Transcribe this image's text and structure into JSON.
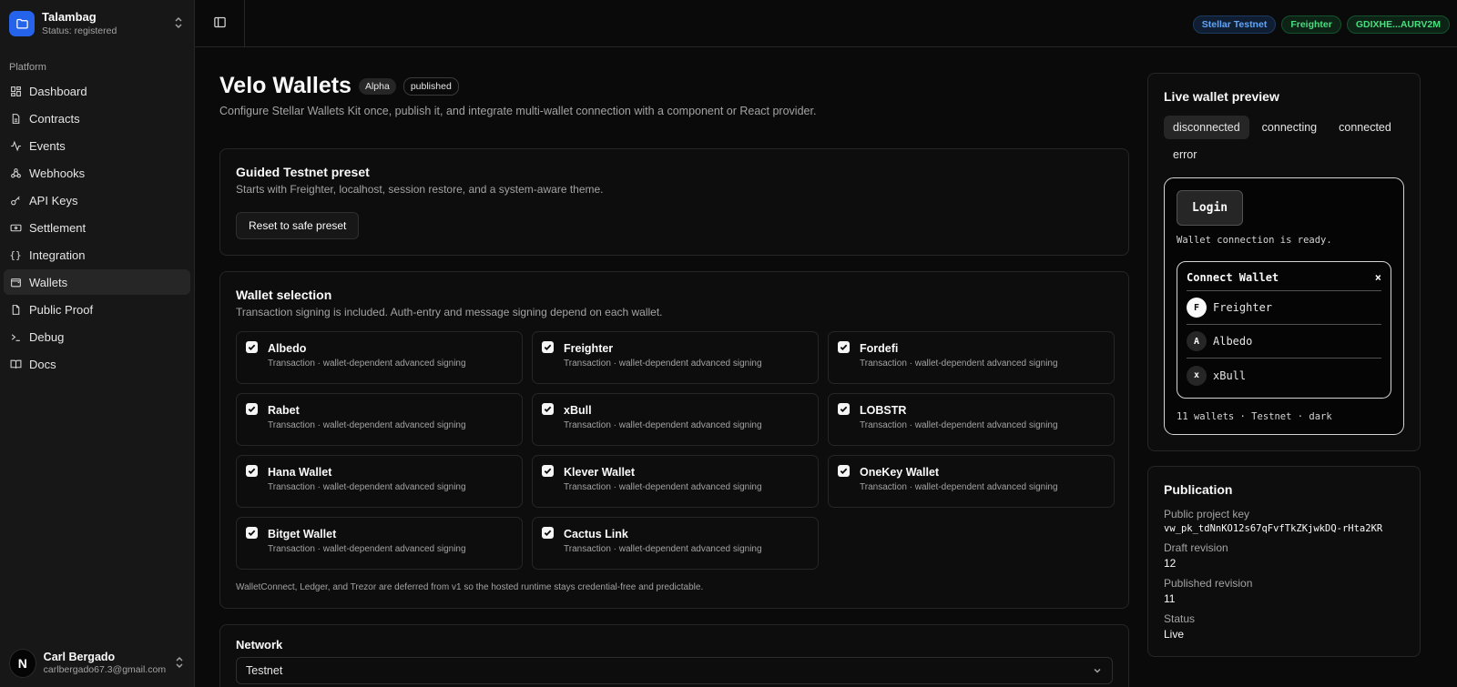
{
  "workspace": {
    "name": "Talambag",
    "status": "Status: registered"
  },
  "sidebar": {
    "group_label": "Platform",
    "items": [
      {
        "label": "Dashboard",
        "icon": "dashboard-icon"
      },
      {
        "label": "Contracts",
        "icon": "document-icon"
      },
      {
        "label": "Events",
        "icon": "activity-icon"
      },
      {
        "label": "Webhooks",
        "icon": "webhook-icon"
      },
      {
        "label": "API Keys",
        "icon": "key-icon"
      },
      {
        "label": "Settlement",
        "icon": "banknote-icon"
      },
      {
        "label": "Integration",
        "icon": "braces-icon"
      },
      {
        "label": "Wallets",
        "icon": "wallet-icon",
        "active": true
      },
      {
        "label": "Public Proof",
        "icon": "file-icon"
      },
      {
        "label": "Debug",
        "icon": "terminal-icon"
      },
      {
        "label": "Docs",
        "icon": "book-icon"
      }
    ]
  },
  "user": {
    "initial": "N",
    "name": "Carl Bergado",
    "email": "carlbergado67.3@gmail.com"
  },
  "topbar": {
    "network": "Stellar Testnet",
    "wallet": "Freighter",
    "account": "GDIXHE...AURV2M"
  },
  "page": {
    "title": "Velo Wallets",
    "badge_alpha": "Alpha",
    "badge_status": "published",
    "subtitle": "Configure Stellar Wallets Kit once, publish it, and integrate multi-wallet connection with a component or React provider."
  },
  "preset": {
    "title": "Guided Testnet preset",
    "desc": "Starts with Freighter, localhost, session restore, and a system-aware theme.",
    "button": "Reset to safe preset"
  },
  "wallet_selection": {
    "title": "Wallet selection",
    "desc": "Transaction signing is included. Auth-entry and message signing depend on each wallet.",
    "items": [
      {
        "name": "Albedo",
        "desc": "Transaction · wallet-dependent advanced signing"
      },
      {
        "name": "Freighter",
        "desc": "Transaction · wallet-dependent advanced signing"
      },
      {
        "name": "Fordefi",
        "desc": "Transaction · wallet-dependent advanced signing"
      },
      {
        "name": "Rabet",
        "desc": "Transaction · wallet-dependent advanced signing"
      },
      {
        "name": "xBull",
        "desc": "Transaction · wallet-dependent advanced signing"
      },
      {
        "name": "LOBSTR",
        "desc": "Transaction · wallet-dependent advanced signing"
      },
      {
        "name": "Hana Wallet",
        "desc": "Transaction · wallet-dependent advanced signing"
      },
      {
        "name": "Klever Wallet",
        "desc": "Transaction · wallet-dependent advanced signing"
      },
      {
        "name": "OneKey Wallet",
        "desc": "Transaction · wallet-dependent advanced signing"
      },
      {
        "name": "Bitget Wallet",
        "desc": "Transaction · wallet-dependent advanced signing"
      },
      {
        "name": "Cactus Link",
        "desc": "Transaction · wallet-dependent advanced signing"
      }
    ],
    "note": "WalletConnect, Ledger, and Trezor are deferred from v1 so the hosted runtime stays credential-free and predictable."
  },
  "network": {
    "label": "Network",
    "value": "Testnet"
  },
  "live_preview": {
    "title": "Live wallet preview",
    "states": [
      "disconnected",
      "connecting",
      "connected",
      "error"
    ],
    "active_state": "disconnected",
    "login": "Login",
    "ready": "Wallet connection is ready.",
    "modal_title": "Connect Wallet",
    "modal_close": "×",
    "modal_items": [
      {
        "letter": "F",
        "name": "Freighter"
      },
      {
        "letter": "A",
        "name": "Albedo"
      },
      {
        "letter": "x",
        "name": "xBull"
      }
    ],
    "footer": "11 wallets · Testnet · dark"
  },
  "publication": {
    "title": "Publication",
    "key_label": "Public project key",
    "key": "vw_pk_tdNnKO12s67qFvfTkZKjwkDQ-rHta2KR",
    "draft_label": "Draft revision",
    "draft": "12",
    "published_label": "Published revision",
    "published": "11",
    "status_label": "Status",
    "status": "Live"
  }
}
